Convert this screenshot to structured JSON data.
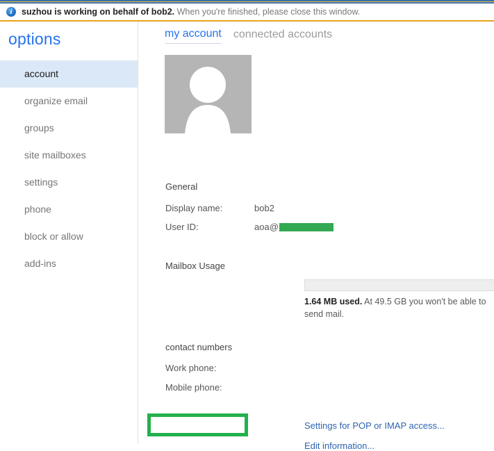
{
  "banner": {
    "icon": "info-icon",
    "bold_text": "suzhou is working on behalf of bob2.",
    "rest_text": " When you're finished, please close this window."
  },
  "sidebar": {
    "title": "options",
    "items": [
      {
        "label": "account",
        "selected": true
      },
      {
        "label": "organize email",
        "selected": false
      },
      {
        "label": "groups",
        "selected": false
      },
      {
        "label": "site mailboxes",
        "selected": false
      },
      {
        "label": "settings",
        "selected": false
      },
      {
        "label": "phone",
        "selected": false
      },
      {
        "label": "block or allow",
        "selected": false
      },
      {
        "label": "add-ins",
        "selected": false
      }
    ]
  },
  "main": {
    "tabs": [
      {
        "label": "my account",
        "active": true
      },
      {
        "label": "connected accounts",
        "active": false
      }
    ],
    "avatar": "user-silhouette-placeholder",
    "general": {
      "heading": "General",
      "display_name_label": "Display name:",
      "display_name_value": "bob2",
      "user_id_label": "User ID:",
      "user_id_value": "aoa@",
      "user_id_redacted": true
    },
    "mailbox_usage": {
      "heading": "Mailbox Usage",
      "progress_percent": 0,
      "used_text": "1.64 MB used.",
      "quota_text": " At 49.5 GB you won't be able to send mail."
    },
    "contact_numbers": {
      "heading": "contact numbers",
      "work_phone_label": "Work phone:",
      "work_phone_value": "",
      "mobile_phone_label": "Mobile phone:",
      "mobile_phone_value": ""
    },
    "links": {
      "pop_imap": "Settings for POP or IMAP access...",
      "edit_information": "Edit information..."
    }
  },
  "colors": {
    "accent_blue": "#2672ec",
    "selected_nav": "#dbe8f7",
    "banner_rule": "#e8a317",
    "redaction_green": "#33a852",
    "highlight_green": "#22b14c"
  }
}
